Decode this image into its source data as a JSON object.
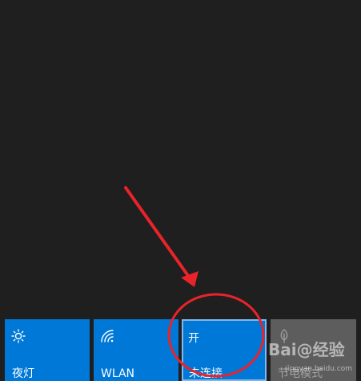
{
  "tiles": {
    "night_light": {
      "label": "夜灯",
      "icon": "brightness-icon"
    },
    "wlan": {
      "label": "WLAN",
      "icon": "wifi-icon"
    },
    "mobile_hotspot": {
      "status": "开",
      "label": "未连接"
    },
    "battery_saver": {
      "label": "节电模式",
      "icon": "leaf-icon"
    }
  },
  "annotation": {
    "arrow_color": "#e8232a",
    "circle_color": "#e8232a"
  },
  "watermark": {
    "logo_text": "Bai@经验",
    "url": "jingyan.baidu.com"
  },
  "colors": {
    "background": "#1f1f1f",
    "tile_active": "#0078d7",
    "tile_inactive": "#5d5d5d",
    "tile_highlight_border": "#84b6ea"
  }
}
